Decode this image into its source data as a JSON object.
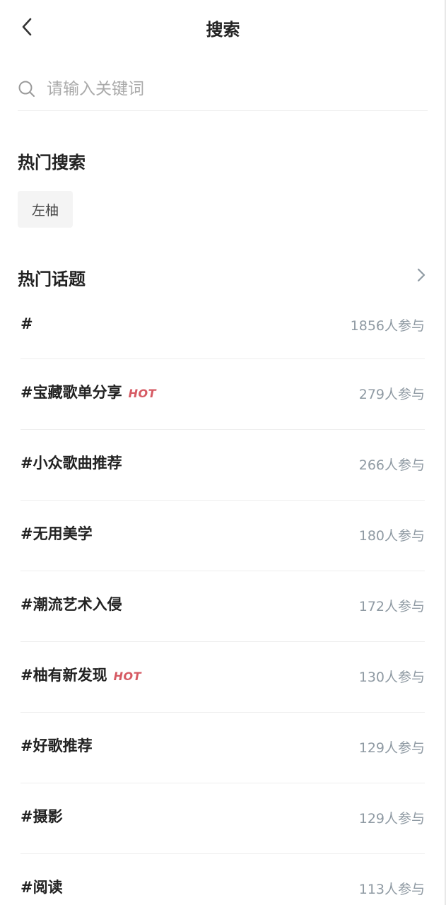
{
  "header": {
    "title": "搜索",
    "back_icon": "chevron-left-icon"
  },
  "search": {
    "placeholder": "请输入关键词",
    "value": "",
    "icon": "search-icon"
  },
  "hot_search": {
    "title": "热门搜索",
    "tags": [
      "左柚"
    ]
  },
  "hot_topics": {
    "title": "热门话题",
    "more_icon": "chevron-right-icon",
    "hot_label": "HOT",
    "hot_color": "#d65a63",
    "items": [
      {
        "name": "#",
        "count": "1856人参与",
        "hot": false
      },
      {
        "name": "#宝藏歌单分享",
        "count": "279人参与",
        "hot": true
      },
      {
        "name": "#小众歌曲推荐",
        "count": "266人参与",
        "hot": false
      },
      {
        "name": "#无用美学",
        "count": "180人参与",
        "hot": false
      },
      {
        "name": "#潮流艺术入侵",
        "count": "172人参与",
        "hot": false
      },
      {
        "name": "#柚有新发现",
        "count": "130人参与",
        "hot": true
      },
      {
        "name": "#好歌推荐",
        "count": "129人参与",
        "hot": false
      },
      {
        "name": "#摄影",
        "count": "129人参与",
        "hot": false
      },
      {
        "name": "#阅读",
        "count": "113人参与",
        "hot": false
      }
    ]
  }
}
